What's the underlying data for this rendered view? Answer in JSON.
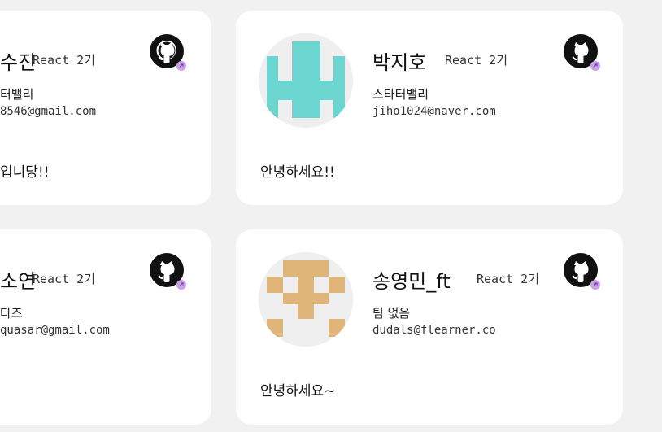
{
  "cards": [
    {
      "name": "수진",
      "cohort": "React 2기",
      "team": "터밸리",
      "email": "8546@gmail.com",
      "intro": "입니당!!",
      "icon": "github-icon",
      "badge_icon": "link-icon"
    },
    {
      "name": "박지호",
      "cohort": "React 2기",
      "team": "스타터밸리",
      "email": "jiho1024@naver.com",
      "intro": "안녕하세요!!",
      "icon": "github-icon",
      "badge_icon": "link-icon",
      "avatar_color": "#6ad6cf"
    },
    {
      "name": "소연",
      "cohort": "React 2기",
      "team": "타즈",
      "email": "quasar@gmail.com",
      "intro": "",
      "icon": "github-icon",
      "badge_icon": "link-icon"
    },
    {
      "name": "송영민_ft",
      "cohort": "React 2기",
      "team": "팀 없음",
      "email": "dudals@flearner.co",
      "intro": "안녕하세요~",
      "icon": "github-icon",
      "badge_icon": "link-icon",
      "avatar_color": "#e0b57a"
    }
  ],
  "colors": {
    "background": "#f1f1f1",
    "card": "#ffffff",
    "badge": "#c9a2e8"
  }
}
